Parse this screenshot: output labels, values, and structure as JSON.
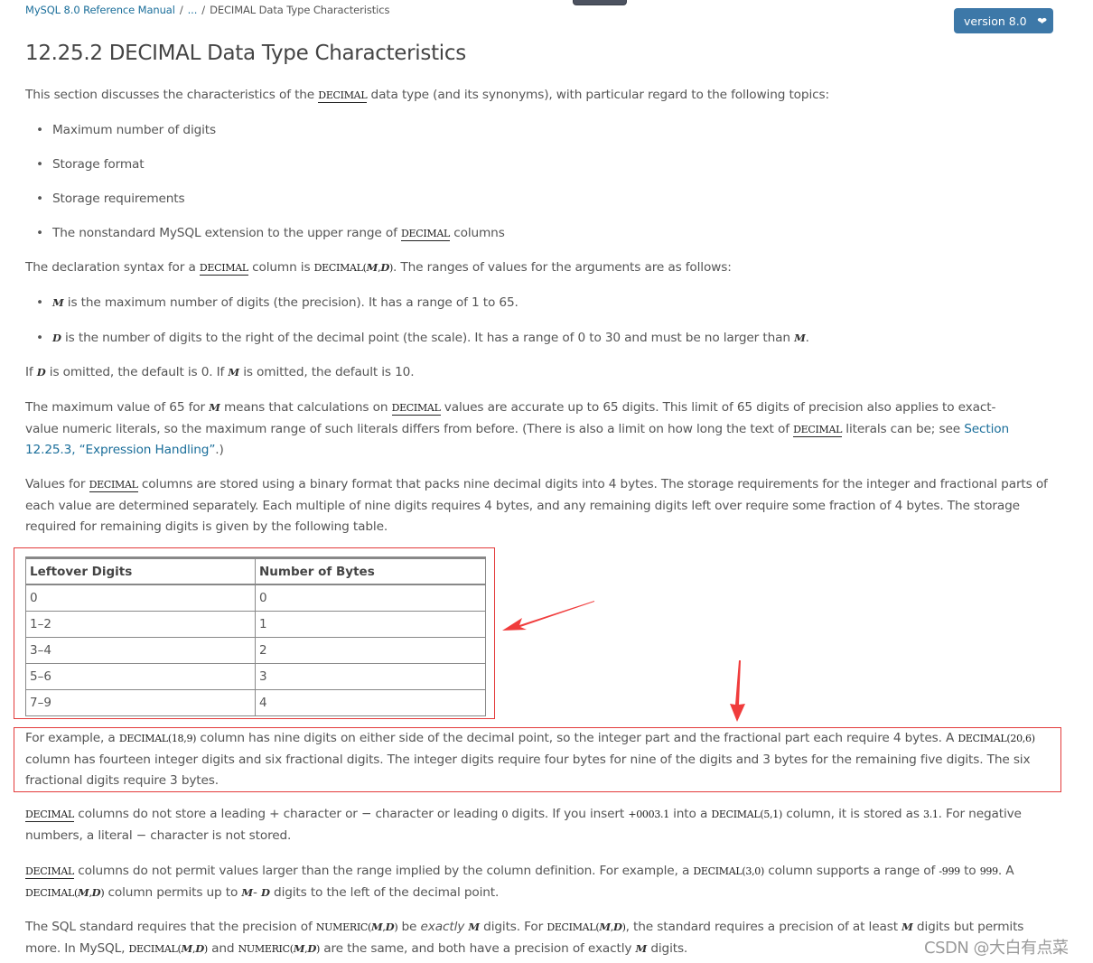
{
  "breadcrumb": {
    "root": "MySQL 8.0 Reference Manual",
    "ellipsis": "...",
    "current": "DECIMAL Data Type Characteristics",
    "separator": "/"
  },
  "version_selector": {
    "label": "version 8.0",
    "icon": "chevron-down-icon"
  },
  "title": "12.25.2 DECIMAL Data Type Characteristics",
  "intro": {
    "before": "This section discusses the characteristics of the ",
    "code": "DECIMAL",
    "after": " data type (and its synonyms), with particular regard to the following topics:"
  },
  "topics": [
    "Maximum number of digits",
    "Storage format",
    "Storage requirements",
    "The nonstandard MySQL extension to the upper range of "
  ],
  "topic4_code": "DECIMAL",
  "topic4_after": " columns",
  "decl": {
    "t1": "The declaration syntax for a ",
    "code1": "DECIMAL",
    "t2": " column is ",
    "code2a": "DECIMAL(",
    "m": "M",
    "comma": ",",
    "d": "D",
    "code2b": ")",
    "t3": ". The ranges of values for the arguments are as follows:"
  },
  "args": [
    {
      "var": "M",
      "text": " is the maximum number of digits (the precision). It has a range of 1 to 65."
    },
    {
      "var": "D",
      "text": " is the number of digits to the right of the decimal point (the scale). It has a range of 0 to 30 and must be no larger than ",
      "var2": "M",
      "end": "."
    }
  ],
  "defaults": {
    "t1": "If ",
    "v1": "D",
    "t2": " is omitted, the default is 0. If ",
    "v2": "M",
    "t3": " is omitted, the default is 10."
  },
  "maxval": {
    "t1": "The maximum value of 65 for ",
    "v1": "M",
    "t2": " means that calculations on ",
    "c1": "DECIMAL",
    "t3": " values are accurate up to 65 digits. This limit of 65 digits of precision also applies to exact-value numeric literals, so the maximum range of such literals differs from before. (There is also a limit on how long the text of ",
    "c2": "DECIMAL",
    "t4": " literals can be; see ",
    "link": "Section 12.25.3, “Expression Handling”",
    "t5": ".)"
  },
  "storage": {
    "t1": "Values for ",
    "c1": "DECIMAL",
    "t2": " columns are stored using a binary format that packs nine decimal digits into 4 bytes. The storage requirements for the integer and fractional parts of each value are determined separately. Each multiple of nine digits requires 4 bytes, and any remaining digits left over require some fraction of 4 bytes. The storage required for remaining digits is given by the following table."
  },
  "table": {
    "headers": [
      "Leftover Digits",
      "Number of Bytes"
    ],
    "rows": [
      [
        "0",
        "0"
      ],
      [
        "1–2",
        "1"
      ],
      [
        "3–4",
        "2"
      ],
      [
        "5–6",
        "3"
      ],
      [
        "7–9",
        "4"
      ]
    ]
  },
  "example": {
    "t1": "For example, a ",
    "c1": "DECIMAL(18,9)",
    "t2": " column has nine digits on either side of the decimal point, so the integer part and the fractional part each require 4 bytes. A ",
    "c2": "DECIMAL(20,6)",
    "t3": " column has fourteen integer digits and six fractional digits. The integer digits require four bytes for nine of the digits and 3 bytes for the remaining five digits. The six fractional digits require 3 bytes."
  },
  "leading": {
    "c1": "DECIMAL",
    "t1": " columns do not store a leading ",
    "plus": "+",
    "t2": " character or ",
    "minus": "−",
    "t3": " character or leading ",
    "c2": "0",
    "t4": " digits. If you insert ",
    "c3": "+0003.1",
    "t5": " into a ",
    "c4": "DECIMAL(5,1)",
    "t6": " column, it is stored as ",
    "c5": "3.1",
    "t7": ". For negative numbers, a literal ",
    "minus2": "−",
    "t8": " character is not stored."
  },
  "range": {
    "c1": "DECIMAL",
    "t1": " columns do not permit values larger than the range implied by the column definition. For example, a ",
    "c2": "DECIMAL(3,0)",
    "t2": " column supports a range of ",
    "c3": "-999",
    "t3": " to ",
    "c4": "999",
    "t4": ". A ",
    "c5a": "DECIMAL(",
    "m": "M",
    "comma": ",",
    "d": "D",
    "c5b": ")",
    "t5": " column permits up to ",
    "v1": "M",
    "minus": "-",
    "v2": "D",
    "t6": " digits to the left of the decimal point."
  },
  "sqlstd": {
    "t1": "The SQL standard requires that the precision of ",
    "c1a": "NUMERIC(",
    "m": "M",
    "comma": ",",
    "d": "D",
    "c1b": ")",
    "t2": " be ",
    "em": "exactly",
    "v1": "M",
    "t3": " digits. For ",
    "c2a": "DECIMAL(",
    "c2b": ")",
    "t4": ", the standard requires a precision of at least ",
    "v2": "M",
    "t5": " digits but permits more. In MySQL, ",
    "c3a": "DECIMAL(",
    "c3b": ")",
    "t6": " and ",
    "c4a": "NUMERIC(",
    "c4b": ")",
    "t7": " are the same, and both have a precision of exactly ",
    "v3": "M",
    "t8": " digits."
  },
  "watermark": "CSDN @大白有点菜",
  "colors": {
    "link": "#1a6e9a",
    "accent": "#3d78a8",
    "annotation": "#e33b3b"
  }
}
